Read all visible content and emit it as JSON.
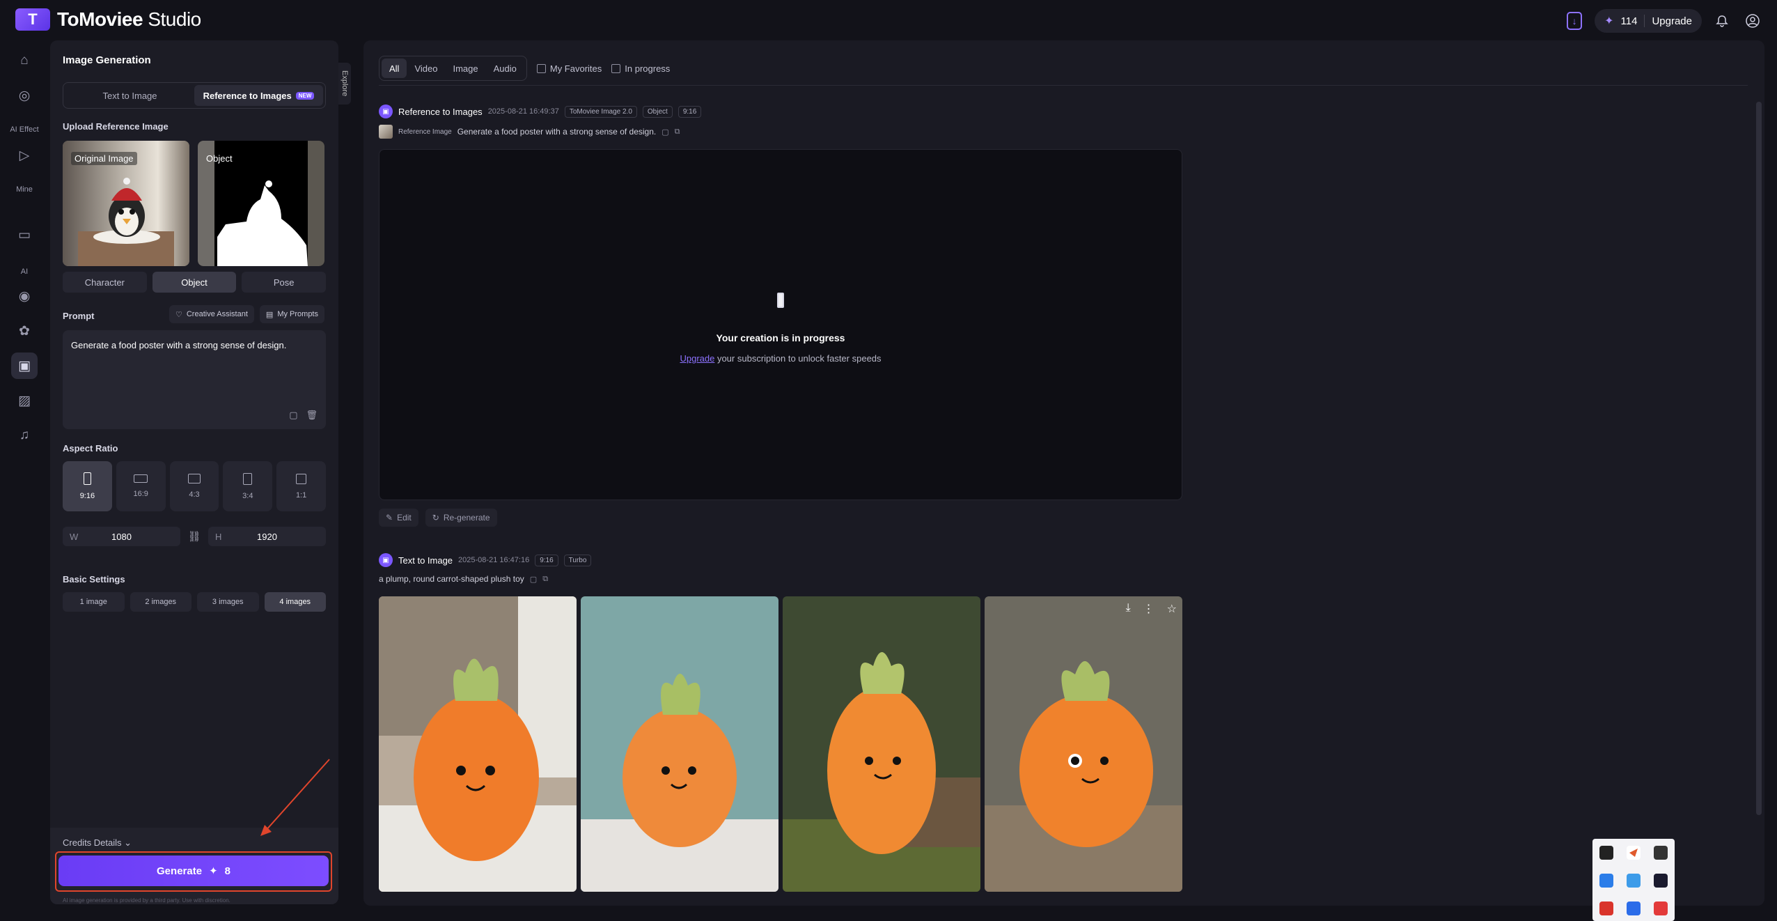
{
  "app": {
    "logo_mark": "T",
    "title_main": "ToMoviee",
    "title_sub": " Studio"
  },
  "topbar": {
    "download_icon": "download-icon",
    "credits": "114",
    "upgrade": "Upgrade",
    "bell_icon": "bell-icon",
    "user_icon": "user-icon"
  },
  "rail": {
    "labels": [
      "AI Effect",
      "Mine",
      "AI"
    ],
    "items": [
      "home-icon",
      "compass-icon",
      "play-effect-icon",
      "folder-icon",
      "video-ai-icon",
      "palette-icon",
      "image-ref-icon",
      "image-edit-icon",
      "music-icon"
    ]
  },
  "panel": {
    "title": "Image Generation",
    "explore": "Explore",
    "tabs": {
      "text_to_image": "Text to Image",
      "reference": "Reference to Images",
      "new_badge": "NEW"
    },
    "upload_label": "Upload Reference Image",
    "ref_original_tag": "Original Image",
    "ref_object_tag": "Object",
    "modes": [
      "Character",
      "Object",
      "Pose"
    ],
    "prompt_label": "Prompt",
    "creative_assistant": "Creative Assistant",
    "my_prompts": "My Prompts",
    "prompt_text": "Generate a food poster with a strong sense of design.",
    "aspect_label": "Aspect Ratio",
    "ratios": [
      "9:16",
      "16:9",
      "4:3",
      "3:4",
      "1:1"
    ],
    "width_label": "W",
    "width_value": "1080",
    "height_label": "H",
    "height_value": "1920",
    "basic_label": "Basic Settings",
    "counts": [
      "1 image",
      "2 images",
      "3 images",
      "4 images"
    ],
    "credits_details": "Credits Details",
    "generate": "Generate",
    "generate_cost": "8",
    "disclaimer": "AI image generation is provided by a third party. Use with discretion."
  },
  "main": {
    "filters": [
      "All",
      "Video",
      "Image",
      "Audio"
    ],
    "my_favorites": "My Favorites",
    "in_progress": "In progress",
    "entry1": {
      "title": "Reference to Images",
      "date": "2025-08-21 16:49:37",
      "chips": [
        "ToMoviee Image 2.0",
        "Object",
        "9:16"
      ],
      "ref_label": "Reference Image",
      "prompt": "Generate a food poster with a strong sense of design.",
      "progress_title": "Your creation is in progress",
      "upgrade_link": "Upgrade",
      "progress_sub": " your subscription to unlock faster speeds",
      "edit": "Edit",
      "regenerate": "Re-generate"
    },
    "entry2": {
      "title": "Text to Image",
      "date": "2025-08-21 16:47:16",
      "chips": [
        "9:16",
        "Turbo"
      ],
      "prompt": "a plump, round carrot-shaped plush toy"
    }
  },
  "colors": {
    "accent": "#7b57ff",
    "highlight": "#e0452c",
    "bg": "#121219"
  }
}
